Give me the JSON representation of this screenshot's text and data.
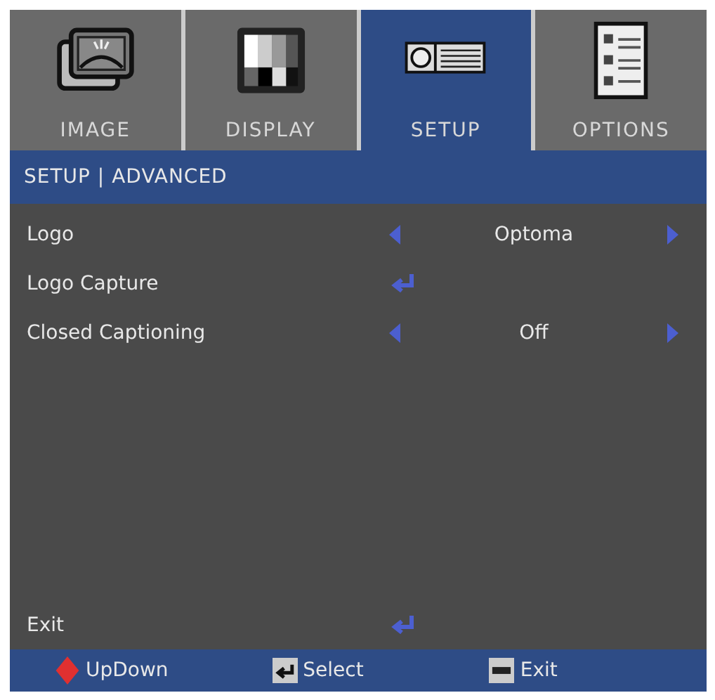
{
  "tabs": [
    {
      "label": "IMAGE",
      "kind": "image",
      "selected": false
    },
    {
      "label": "DISPLAY",
      "kind": "display",
      "selected": false
    },
    {
      "label": "SETUP",
      "kind": "setup",
      "selected": true
    },
    {
      "label": "OPTIONS",
      "kind": "options",
      "selected": false
    }
  ],
  "header": "SETUP | ADVANCED",
  "items": [
    {
      "kind": "select",
      "label": "Logo",
      "value": "Optoma"
    },
    {
      "kind": "enter",
      "label": "Logo Capture"
    },
    {
      "kind": "select",
      "label": "Closed Captioning",
      "value": "Off"
    }
  ],
  "exit_item": {
    "kind": "enter",
    "label": "Exit"
  },
  "footer": [
    {
      "kind": "updown",
      "label": "UpDown"
    },
    {
      "kind": "enter",
      "label": "Select"
    },
    {
      "kind": "menu",
      "label": "Exit"
    }
  ]
}
